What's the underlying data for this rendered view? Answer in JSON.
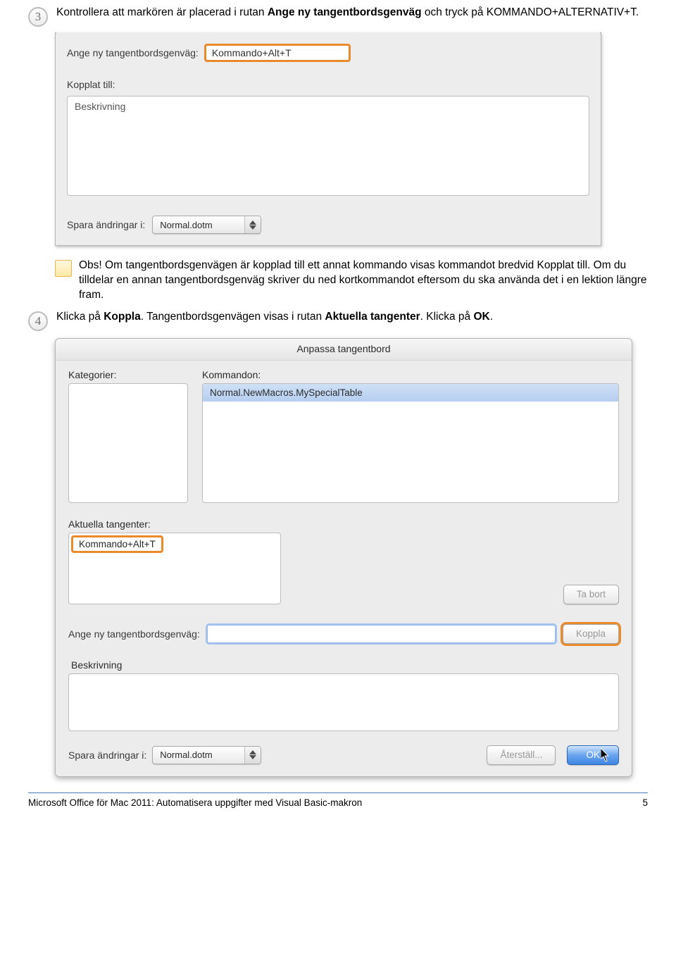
{
  "step3": {
    "num": "3",
    "pre": "Kontrollera att markören är placerad i rutan ",
    "bold": "Ange ny tangentbordsgenväg",
    "post": " och tryck på KOMMANDO+ALTERNATIV+T."
  },
  "note": {
    "obs": "Obs!",
    "t1": " Om tangentbordsgenvägen är kopplad till ett annat kommando visas kommandot bredvid ",
    "b1": "Kopplat till",
    "t2": ". Om du tilldelar en annan tangentbordsgenväg skriver du ned kortkommandot eftersom du ska använda det i en lektion längre fram."
  },
  "step4": {
    "num": "4",
    "pre": "Klicka på ",
    "b1": "Koppla",
    "mid": ". Tangentbordsgenvägen visas i rutan ",
    "b2": "Aktuella tangenter",
    "mid2": ". Klicka på ",
    "b3": "OK",
    "end": "."
  },
  "shot1": {
    "shortcut_label": "Ange ny tangentbordsgenväg:",
    "shortcut_value": "Kommando+Alt+T",
    "linked_label": "Kopplat till:",
    "desc_title": "Beskrivning",
    "save_label": "Spara ändringar i:",
    "save_value": "Normal.dotm"
  },
  "shot2": {
    "title": "Anpassa tangentbord",
    "cats_label": "Kategorier:",
    "cmds_label": "Kommandon:",
    "cmd_sel": "Normal.NewMacros.MySpecialTable",
    "curkeys_label": "Aktuella tangenter:",
    "curkeys_value": "Kommando+Alt+T",
    "remove_btn": "Ta bort",
    "assign_label": "Ange ny tangentbordsgenväg:",
    "assign_btn": "Koppla",
    "desc_label": "Beskrivning",
    "save_label": "Spara ändringar i:",
    "save_value": "Normal.dotm",
    "reset_btn": "Återställ...",
    "ok_btn": "OK"
  },
  "footer": {
    "left": "Microsoft Office för Mac 2011: Automatisera uppgifter med Visual Basic-makron",
    "page": "5"
  }
}
